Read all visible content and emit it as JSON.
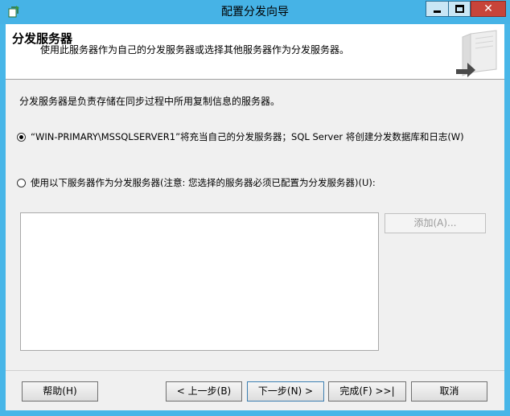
{
  "window": {
    "title": "配置分发向导"
  },
  "header": {
    "title": "分发服务器",
    "subtitle": "使用此服务器作为自己的分发服务器或选择其他服务器作为分发服务器。"
  },
  "content": {
    "intro": "分发服务器是负责存储在同步过程中所用复制信息的服务器。",
    "option_self": {
      "label": "“WIN-PRIMARY\\MSSQLSERVER1”将充当自己的分发服务器；SQL Server 将创建分发数据库和日志(W)",
      "selected": true
    },
    "option_other": {
      "label": "使用以下服务器作为分发服务器(注意: 您选择的服务器必须已配置为分发服务器)(U):",
      "selected": false
    },
    "add_button": "添加(A)..."
  },
  "footer": {
    "help": "帮助(H)",
    "back": "< 上一步(B)",
    "next": "下一步(N) >",
    "finish": "完成(F) >>|",
    "cancel": "取消"
  },
  "colors": {
    "titlebar": "#46b3e6",
    "close_button": "#c7443a",
    "client_background": "#f0f0f0"
  }
}
